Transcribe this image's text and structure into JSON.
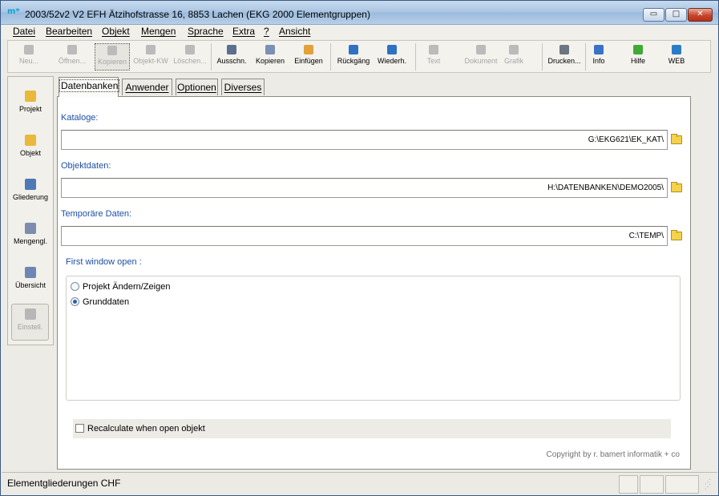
{
  "window": {
    "title": "2003/52v2 V2 EFH Ätzihofstrasse 16, 8853 Lachen (EKG 2000 Elementgruppen)",
    "app_icon": "m*",
    "buttons": {
      "minimize": "▭",
      "maximize": "□",
      "close": "✕"
    }
  },
  "menubar": {
    "items": [
      "Datei",
      "Bearbeiten",
      "Objekt",
      "Mengen",
      "Sprache",
      "Extra",
      "?",
      "Ansicht"
    ]
  },
  "toolbar": {
    "buttons": [
      {
        "label": "Neu...",
        "enabled": false,
        "icon": "new-icon",
        "color": ""
      },
      {
        "label": "Öffnen...",
        "enabled": false,
        "icon": "open-icon",
        "color": ""
      },
      {
        "label": "Kopieren",
        "enabled": false,
        "icon": "copy-object-icon",
        "color": ""
      },
      {
        "label": "Objekt-KW",
        "enabled": false,
        "icon": "object-kw-icon",
        "color": ""
      },
      {
        "label": "Löschen...",
        "enabled": false,
        "icon": "delete-icon",
        "color": ""
      },
      {
        "label": "Ausschn.",
        "enabled": true,
        "icon": "cut-icon",
        "color": "#5b6f8f"
      },
      {
        "label": "Kopieren",
        "enabled": true,
        "icon": "copy-icon",
        "color": "#7a90b4"
      },
      {
        "label": "Einfügen",
        "enabled": true,
        "icon": "paste-icon",
        "color": "#e3a13a"
      },
      {
        "label": "Rückgäng",
        "enabled": true,
        "icon": "undo-icon",
        "color": "#2f72c4"
      },
      {
        "label": "Wiederh.",
        "enabled": true,
        "icon": "redo-icon",
        "color": "#2f72c4"
      },
      {
        "label": "Text",
        "enabled": false,
        "icon": "text-icon",
        "color": ""
      },
      {
        "label": "Dokument",
        "enabled": false,
        "icon": "document-icon",
        "color": ""
      },
      {
        "label": "Grafik",
        "enabled": false,
        "icon": "graphic-icon",
        "color": ""
      },
      {
        "label": "Drucken...",
        "enabled": true,
        "icon": "printer-icon",
        "color": "#6d7482"
      },
      {
        "label": "Info",
        "enabled": true,
        "icon": "info-icon",
        "color": "#3a72c6"
      },
      {
        "label": "Hilfe",
        "enabled": true,
        "icon": "help-icon",
        "color": "#3faa34"
      },
      {
        "label": "WEB",
        "enabled": true,
        "icon": "globe-icon",
        "color": "#2a7cc9"
      }
    ]
  },
  "sidebar": {
    "items": [
      {
        "label": "Projekt",
        "icon": "project-icon",
        "color": "#e8b93a",
        "enabled": true
      },
      {
        "label": "Objekt",
        "icon": "object-icon",
        "color": "#e8b93a",
        "enabled": true
      },
      {
        "label": "Gliederung",
        "icon": "structure-icon",
        "color": "#4e79b6",
        "enabled": true
      },
      {
        "label": "Mengengl.",
        "icon": "quantity-icon",
        "color": "#7c8db0",
        "enabled": true
      },
      {
        "label": "Übersicht",
        "icon": "overview-icon",
        "color": "#6d86b5",
        "enabled": true
      },
      {
        "label": "Einstell.",
        "icon": "settings-icon",
        "color": "",
        "enabled": false
      }
    ]
  },
  "tabs": [
    {
      "label": "Datenbanken",
      "active": true
    },
    {
      "label": "Anwender",
      "active": false
    },
    {
      "label": "Optionen",
      "active": false
    },
    {
      "label": "Diverses",
      "active": false
    }
  ],
  "panel": {
    "fields": [
      {
        "label": "Kataloge:",
        "value": "G:\\EKG621\\EK_KAT\\"
      },
      {
        "label": "Objektdaten:",
        "value": "H:\\DATENBANKEN\\DEMO2005\\"
      },
      {
        "label": "Temporäre Daten:",
        "value": "C:\\TEMP\\"
      }
    ],
    "group_label": "First window open :",
    "radios": [
      {
        "label": "Projekt Ändern/Zeigen",
        "checked": false
      },
      {
        "label": "Grunddaten",
        "checked": true
      }
    ],
    "recalc_label": "Recalculate when open objekt",
    "recalc_checked": false,
    "copyright": "Copyright by r. bamert informatik + co"
  },
  "statusbar": {
    "text": "Elementgliederungen CHF"
  },
  "colors": {
    "label_blue": "#1f4ea3",
    "title_gradient": "#a9c4e2"
  }
}
